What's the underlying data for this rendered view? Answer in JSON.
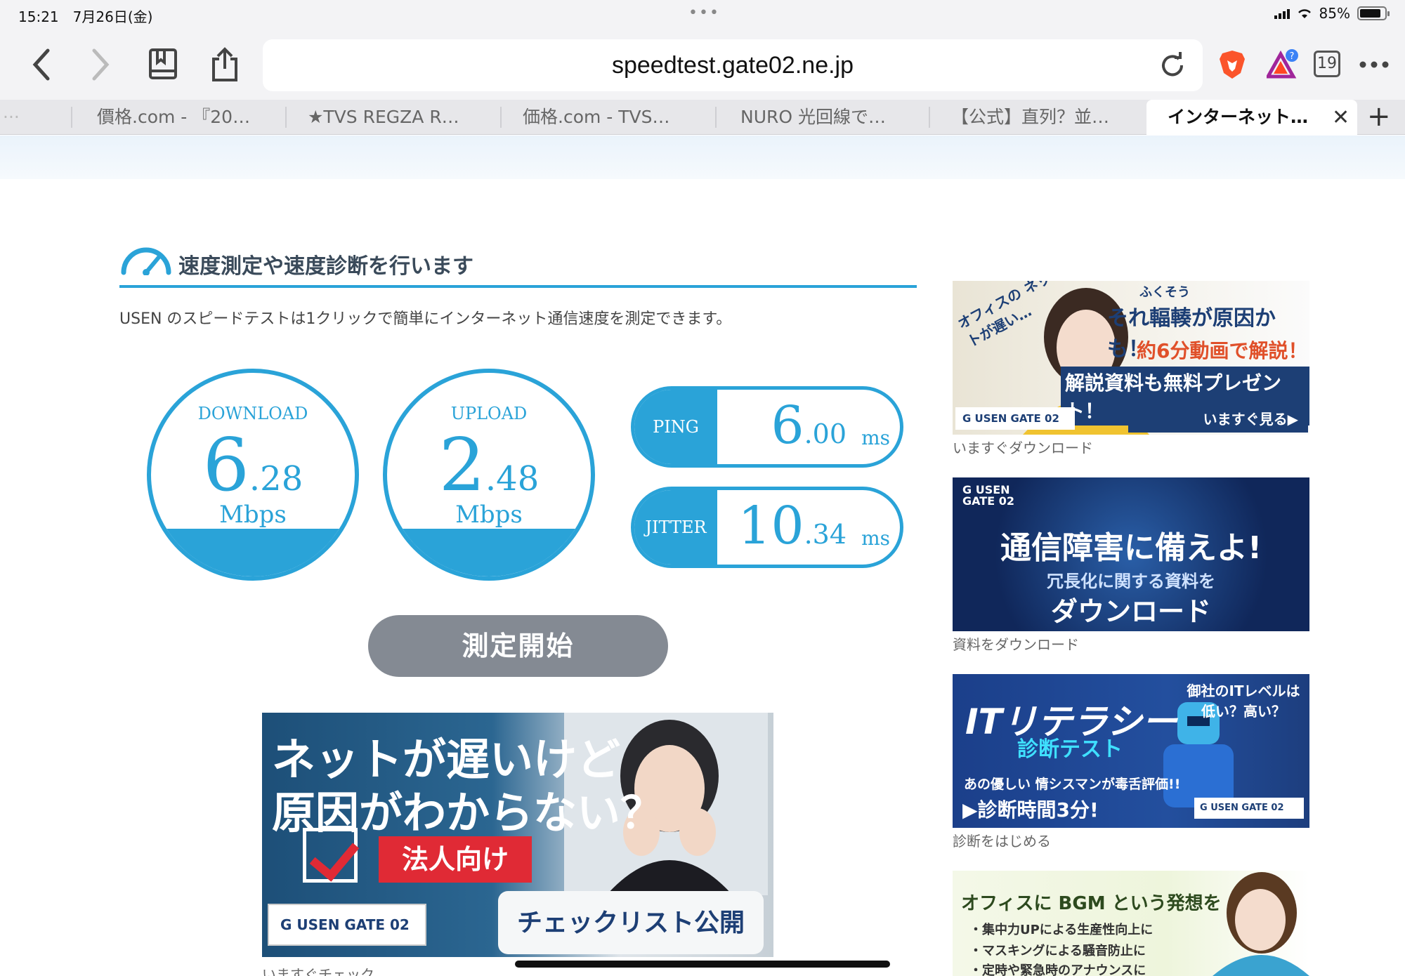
{
  "status_bar": {
    "time": "15:21",
    "date": "7月26日(金)",
    "battery": "85%",
    "battery_level": 0.85
  },
  "toolbar": {
    "url": "speedtest.gate02.ne.jp",
    "tab_count": "19",
    "brave_badge": "?"
  },
  "tabs": [
    {
      "label": "價格.com - 『20…"
    },
    {
      "label": "★TVS REGZA R…"
    },
    {
      "label": "価格.com - TVS…"
    },
    {
      "label": "NURO 光回線で…"
    },
    {
      "label": "【公式】直列？並…"
    },
    {
      "label": "インターネット…"
    }
  ],
  "page": {
    "section_title": "速度測定や速度診断を行います",
    "description": "USEN のスピードテストは1クリックで簡単にインターネット通信速度を測定できます。",
    "download": {
      "label": "DOWNLOAD",
      "int": "6",
      "dec": ".28",
      "unit": "Mbps"
    },
    "upload": {
      "label": "UPLOAD",
      "int": "2",
      "dec": ".48",
      "unit": "Mbps"
    },
    "ping": {
      "label": "PING",
      "int": "6",
      "dec": ".00",
      "unit": "ms"
    },
    "jitter": {
      "label": "JITTER",
      "int": "10",
      "dec": ".34",
      "unit": "ms"
    },
    "start_button": "測定開始"
  },
  "main_banner": {
    "line1": "ネットが遅いけど",
    "line2": "原因がわからない？",
    "tag": "法人向け",
    "logo": "USEN GATE 02",
    "cta": "チェックリスト公開中！>",
    "caption": "いますぐチェック"
  },
  "sidebar_ads": [
    {
      "text_a": "オフィスの ネットが遅い…",
      "text_b": "ふくそう",
      "text_c": "それ輻輳が原因かも！",
      "text_d": "約6分動画で解説！",
      "text_e": "解説資料も無料プレゼント！",
      "logo": "USEN GATE 02",
      "cta": "いますぐ見る▶",
      "caption": "いますぐダウンロード"
    },
    {
      "logo": "USEN GATE 02",
      "headline": "通信障害に備えよ!",
      "sub1": "冗長化に関する資料を",
      "sub2": "ダウンロード",
      "caption": "資料をダウンロード"
    },
    {
      "headline": "ITリテラシー",
      "sub": "診断テスト",
      "corner": "御社のITレベルは 低い？高い？",
      "line": "あの優しい 情シスマンが毒舌評価!!",
      "time": "▶診断時間3分!",
      "logo": "USEN GATE 02",
      "caption": "診断をはじめる"
    },
    {
      "headline": "オフィスに BGM という発想を",
      "b1": "・集中力UPによる生産性向上に",
      "b2": "・マスキングによる騒音防止に",
      "b3": "・定時や緊急時のアナウンスに"
    }
  ]
}
